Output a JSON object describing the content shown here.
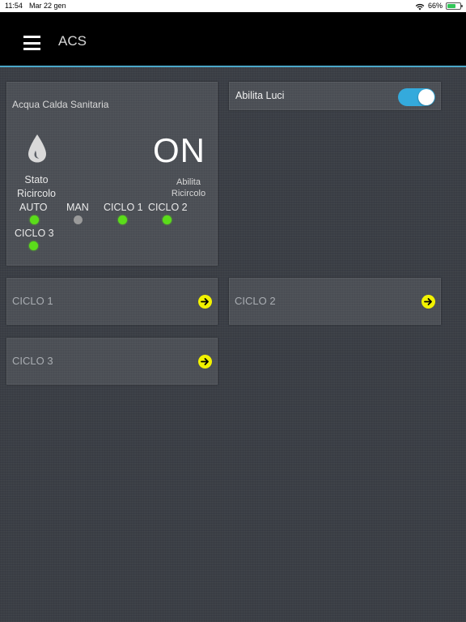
{
  "status_bar": {
    "time": "11:54",
    "date": "Mar 22 gen",
    "battery": "66%",
    "battery_level": 0.66,
    "icons": [
      "wifi-icon",
      "battery-icon"
    ]
  },
  "header": {
    "title": "ACS",
    "menu_icon": "hamburger-menu-icon",
    "accent_color": "#4aa7c9"
  },
  "acs_card": {
    "title": "Acqua Calda Sanitaria",
    "icon": "water-drop-icon",
    "status_value": "ON",
    "stato_label_line1": "Stato",
    "stato_label_line2": "Ricircolo",
    "abilita_label_line1": "Abilita",
    "abilita_label_line2": "Ricircolo",
    "modes": [
      {
        "label": "AUTO",
        "led": "green"
      },
      {
        "label": "MAN",
        "led": "gray"
      },
      {
        "label": "CICLO 1",
        "led": "green"
      },
      {
        "label": "CICLO 2",
        "led": "green"
      },
      {
        "label": "CICLO 3",
        "led": "green"
      }
    ]
  },
  "lights": {
    "label": "Abilita Luci",
    "enabled": true,
    "toggle_color": "#34aadc"
  },
  "cycles": [
    {
      "label": "CICLO 1",
      "icon": "arrow-right-circle-icon"
    },
    {
      "label": "CICLO 2",
      "icon": "arrow-right-circle-icon"
    },
    {
      "label": "CICLO 3",
      "icon": "arrow-right-circle-icon"
    }
  ],
  "colors": {
    "led_on": "#5bdc1a",
    "led_off": "#9a9a9a",
    "arrow": "#f2f200"
  }
}
